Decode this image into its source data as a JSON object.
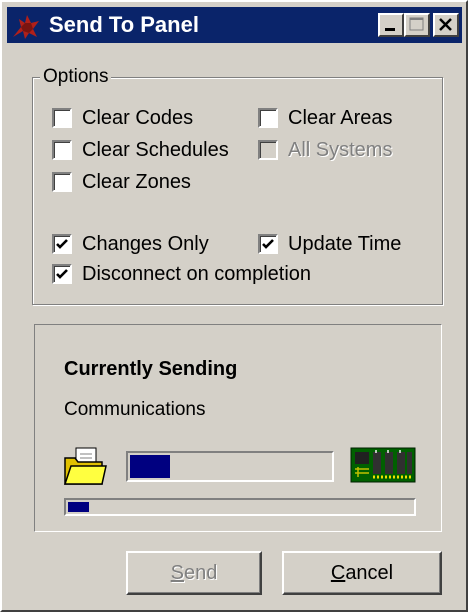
{
  "window": {
    "title": "Send To Panel"
  },
  "title_buttons": {
    "minimize": "minimize-icon",
    "maximize": "maximize-icon",
    "close": "close-icon"
  },
  "options": {
    "group_label": "Options",
    "clear_codes": {
      "label": "Clear Codes",
      "checked": false,
      "enabled": true
    },
    "clear_areas": {
      "label": "Clear Areas",
      "checked": false,
      "enabled": true
    },
    "clear_schedules": {
      "label": "Clear Schedules",
      "checked": false,
      "enabled": true
    },
    "all_systems": {
      "label": "All Systems",
      "checked": false,
      "enabled": false
    },
    "clear_zones": {
      "label": "Clear Zones",
      "checked": false,
      "enabled": true
    },
    "changes_only": {
      "label": "Changes Only",
      "checked": true,
      "enabled": true
    },
    "update_time": {
      "label": "Update Time",
      "checked": true,
      "enabled": true
    },
    "disconnect": {
      "label": "Disconnect on completion",
      "checked": true,
      "enabled": true
    }
  },
  "status": {
    "title": "Currently Sending",
    "message": "Communications",
    "current_progress": 0.2,
    "overall_progress": 0.06,
    "source_icon": "folder-icon",
    "target_icon": "circuit-board-icon"
  },
  "buttons": {
    "send": {
      "mnemonic": "S",
      "rest": "end",
      "enabled": false
    },
    "cancel": {
      "mnemonic": "C",
      "rest": "ancel",
      "enabled": true
    }
  },
  "colors": {
    "titlebar": "#0a246a",
    "progress_fill": "#000080",
    "face": "#d4d0c8"
  }
}
